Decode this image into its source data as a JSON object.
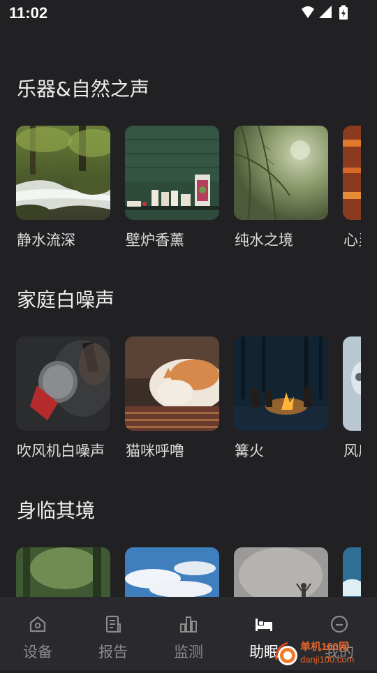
{
  "status_bar": {
    "time": "11:02",
    "icons": [
      "wifi-icon",
      "signal-icon",
      "battery-charging-icon"
    ]
  },
  "sections": [
    {
      "title": "乐器&自然之声",
      "items": [
        {
          "label": "静水流深",
          "image": "forest-stream"
        },
        {
          "label": "壁炉香薰",
          "image": "candles-shelf"
        },
        {
          "label": "纯水之境",
          "image": "pine-branches"
        },
        {
          "label": "心灵",
          "image": "warm-lights"
        }
      ]
    },
    {
      "title": "家庭白噪声",
      "items": [
        {
          "label": "吹风机白噪声",
          "image": "hair-dryer"
        },
        {
          "label": "猫咪呼噜",
          "image": "sleeping-cat"
        },
        {
          "label": "篝火",
          "image": "campfire-night"
        },
        {
          "label": "风扇",
          "image": "fan"
        }
      ]
    },
    {
      "title": "身临其境",
      "items": [
        {
          "label": "",
          "image": "misty-forest"
        },
        {
          "label": "",
          "image": "blue-sky"
        },
        {
          "label": "",
          "image": "foggy-figure"
        },
        {
          "label": "",
          "image": "ocean-waves"
        }
      ]
    }
  ],
  "tabs": [
    {
      "label": "设备",
      "icon": "home-icon",
      "active": false
    },
    {
      "label": "报告",
      "icon": "report-icon",
      "active": false
    },
    {
      "label": "监测",
      "icon": "bar-chart-icon",
      "active": false
    },
    {
      "label": "助眠",
      "icon": "bed-icon",
      "active": true
    },
    {
      "label": "我的",
      "icon": "profile-icon",
      "active": false
    }
  ],
  "watermark": {
    "line1": "单机100网",
    "line2": "danji100.com"
  }
}
